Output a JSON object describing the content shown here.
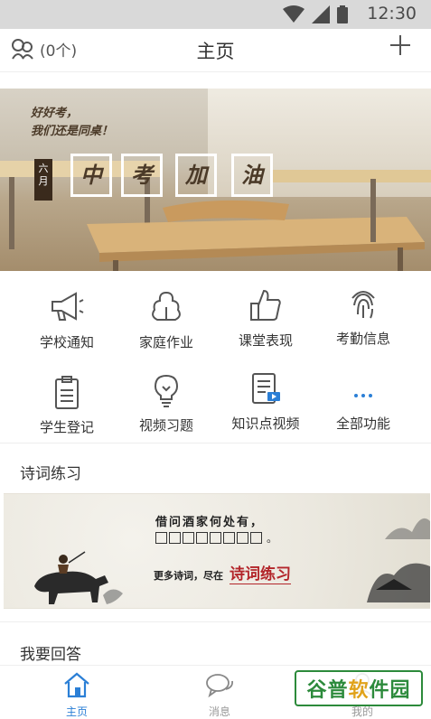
{
  "status_bar": {
    "time": "12:30"
  },
  "header": {
    "count_label": "(0个)",
    "title": "主页"
  },
  "banner": {
    "slogan_line1": "好好考，",
    "slogan_line2": "我们还是同桌！",
    "month": "六月",
    "cheer_chars": [
      "中",
      "考",
      "加",
      "油"
    ]
  },
  "features": [
    {
      "label": "学校通知",
      "icon": "megaphone-icon"
    },
    {
      "label": "家庭作业",
      "icon": "homework-icon"
    },
    {
      "label": "课堂表现",
      "icon": "thumbs-up-icon"
    },
    {
      "label": "考勤信息",
      "icon": "fingerprint-icon"
    },
    {
      "label": "学生登记",
      "icon": "clipboard-icon"
    },
    {
      "label": "视频习题",
      "icon": "lightbulb-icon"
    },
    {
      "label": "知识点视频",
      "icon": "video-doc-icon"
    },
    {
      "label": "全部功能",
      "icon": "more-dots-icon"
    }
  ],
  "poetry": {
    "section_title": "诗词练习",
    "verse": "借问酒家何处有，",
    "more_text": "更多诗词，尽在",
    "link_text": "诗词练习"
  },
  "answer": {
    "section_title": "我要回答"
  },
  "tabs": [
    {
      "label": "主页"
    },
    {
      "label": "消息"
    },
    {
      "label": "我的"
    }
  ],
  "watermark": {
    "text": "谷普软件园"
  },
  "colors": {
    "accent": "#2b7fd6",
    "icon_gray": "#555555",
    "poem_red": "#b3262b",
    "watermark_green": "#2c8a3b"
  }
}
